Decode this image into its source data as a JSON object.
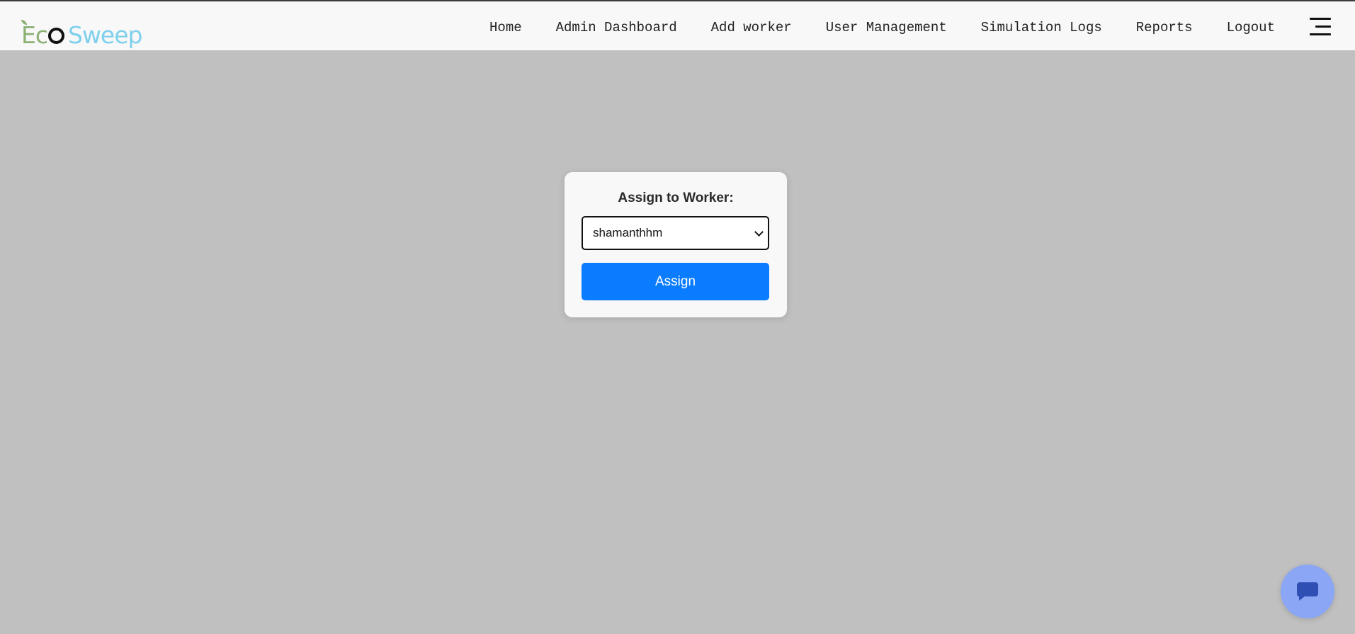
{
  "brand": {
    "logo_eco": "Ec",
    "logo_sweep": "Sweep",
    "colors": {
      "eco": "#8bb174",
      "sweep": "#7fd0ec"
    }
  },
  "nav": {
    "items": [
      {
        "label": "Home"
      },
      {
        "label": "Admin Dashboard"
      },
      {
        "label": "Add worker"
      },
      {
        "label": "User Management"
      },
      {
        "label": "Simulation Logs"
      },
      {
        "label": "Reports"
      },
      {
        "label": "Logout"
      }
    ],
    "menu_icon": "hamburger-menu-icon"
  },
  "assign_panel": {
    "title": "Assign to Worker:",
    "selected_worker": "shamanthhm",
    "assign_label": "Assign",
    "accent": "#0a7cff"
  },
  "chat": {
    "icon": "chat-bubble-icon",
    "color": "#8aa6f4"
  }
}
